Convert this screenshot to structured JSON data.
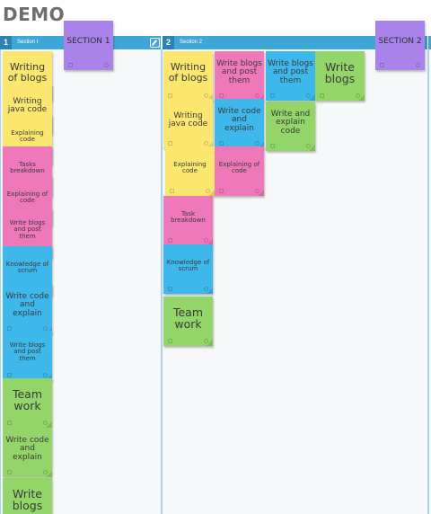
{
  "board": {
    "title": "DEMO"
  },
  "columns": [
    {
      "number": "1",
      "name": "Section I"
    },
    {
      "number": "2",
      "name": "Section 2"
    }
  ],
  "section_notes": [
    "SECTION 1",
    "SECTION 2"
  ],
  "notes_col1": [
    "Writing of blogs",
    "Writing java code",
    "Explaining code",
    "Tasks breakdown",
    "Explaining of code",
    "Write blogs and post them",
    "Knowledge of scrum",
    "Write code and explain",
    "Write blogs and post them",
    "Team work",
    "Write code and explain",
    "Write blogs"
  ],
  "notes_col2": [
    "Writing of blogs",
    "Write blogs and post them",
    "Write blogs and post them",
    "Write blogs",
    "Writing java code",
    "Write code and explain",
    "Write and explain code",
    "Explaining code",
    "Explaining of code",
    "Task breakdown",
    "Knowledge of scrum",
    "Team work"
  ],
  "colors": {
    "yellow": "#fbe76f",
    "pink": "#ef78ba",
    "blue": "#3eb8ea",
    "green": "#94d569",
    "purple": "#a983e9",
    "header": "#3fa6d8"
  }
}
